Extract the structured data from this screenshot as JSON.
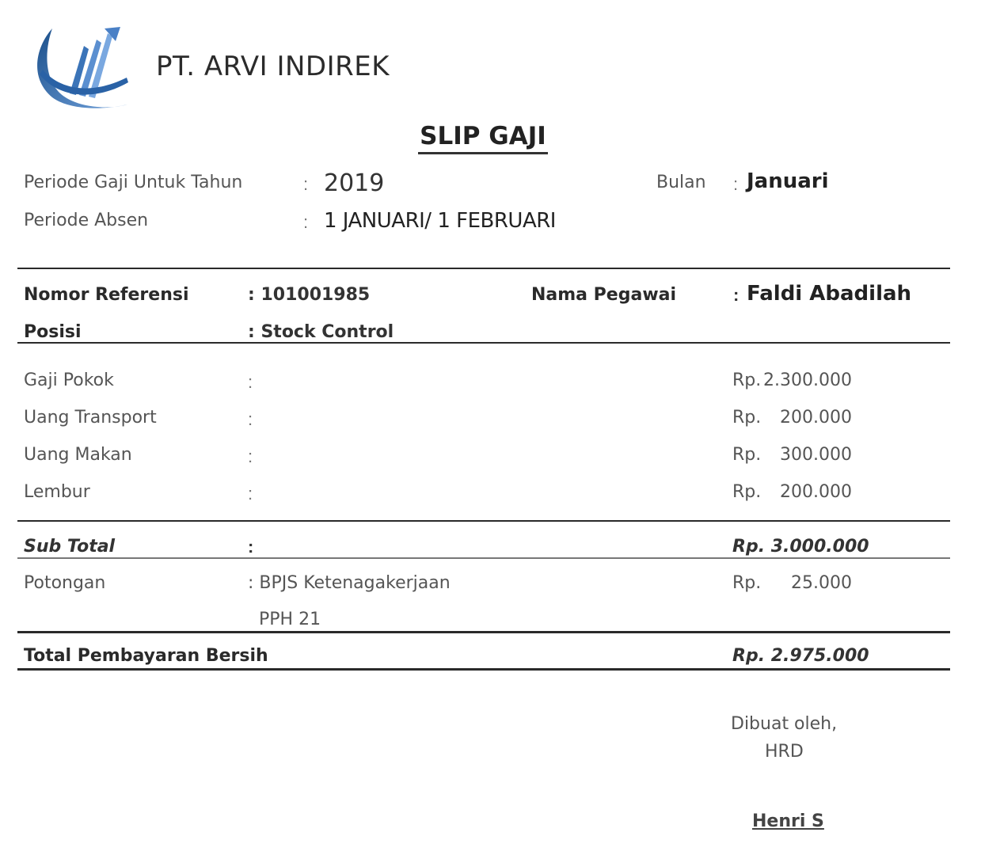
{
  "company": {
    "name": "PT.  ARVI INDIREK"
  },
  "document": {
    "title": "SLIP GAJI"
  },
  "period": {
    "year_label": "Periode Gaji Untuk Tahun",
    "year_value": "2019",
    "month_label": "Bulan",
    "month_value": "Januari",
    "absence_label": "Periode Absen",
    "absence_value": "1 JANUARI/ 1 FEBRUARI"
  },
  "employee": {
    "ref_label": "Nomor Referensi",
    "ref_value": ": 101001985",
    "name_label": "Nama Pegawai",
    "name_value": "Faldi Abadilah",
    "position_label": "Posisi",
    "position_value": ": Stock Control"
  },
  "earnings": [
    {
      "label": "Gaji Pokok",
      "currency": "Rp.",
      "amount": "2.300.000"
    },
    {
      "label": "Uang Transport",
      "currency": "Rp.",
      "amount": "200.000"
    },
    {
      "label": "Uang Makan",
      "currency": "Rp.",
      "amount": "300.000"
    },
    {
      "label": "Lembur",
      "currency": "Rp.",
      "amount": "200.000"
    }
  ],
  "subtotal": {
    "label": "Sub Total",
    "amount": "Rp. 3.000.000"
  },
  "deductions": {
    "label": "Potongan",
    "items": [
      {
        "name": ": BPJS Ketenagakerjaan",
        "currency": "Rp.",
        "amount": "25.000"
      },
      {
        "name": "PPH 21"
      }
    ]
  },
  "total": {
    "label": "Total Pembayaran Bersih",
    "amount": "Rp. 2.975.000"
  },
  "signature": {
    "made_by": "Dibuat oleh,",
    "department": "HRD",
    "name": "Henri S"
  },
  "colors": {
    "logo_dark": "#1b4f8a",
    "logo_light": "#5b8fd0",
    "text": "#2a2a2a"
  },
  "icons": {
    "logo": "company-logo-swoosh"
  }
}
